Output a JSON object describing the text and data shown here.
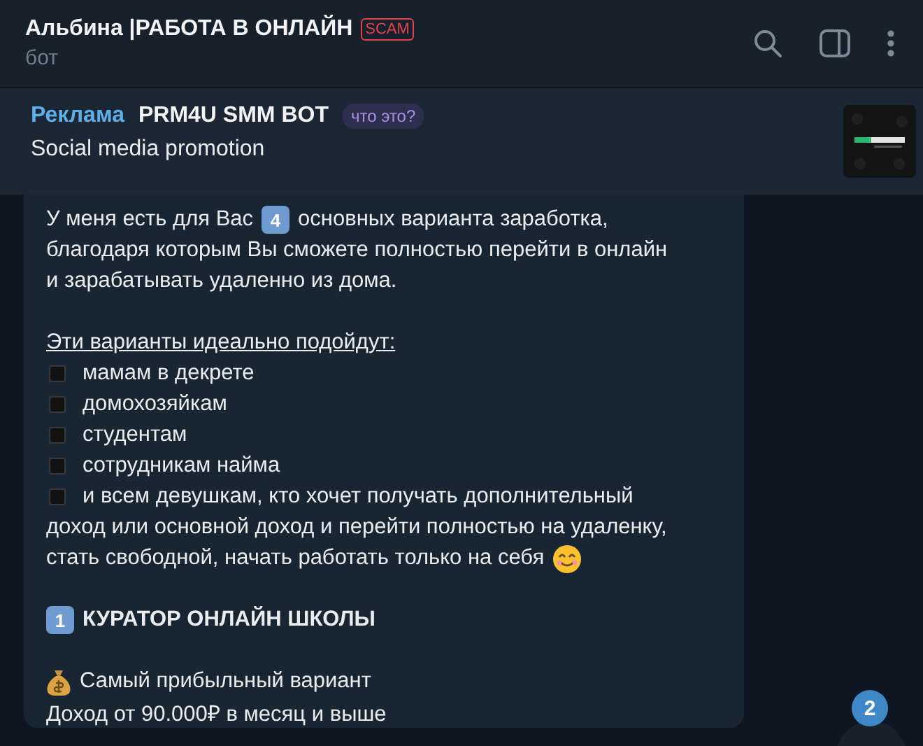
{
  "header": {
    "title": "Альбина |РАБОТА В ОНЛАЙН",
    "badge": "SCAM",
    "subtitle": "бот"
  },
  "sponsored": {
    "label": "Реклама",
    "name": "PRM4U SMM BOT",
    "hint": "что это?",
    "text": "Social media promotion"
  },
  "message": {
    "lines": [
      {
        "kind": "keycap_text",
        "before": "У меня есть для Вас",
        "keycap": "4",
        "after": "основных варианта заработка,"
      },
      {
        "kind": "text",
        "text": "благодаря которым Вы сможете полностью перейти в онлайн"
      },
      {
        "kind": "text",
        "text": "и зарабатывать удаленно из дома."
      },
      {
        "kind": "blank"
      },
      {
        "kind": "underline",
        "text": "Эти варианты идеально подойдут:"
      },
      {
        "kind": "bullet",
        "text": "мамам в декрете"
      },
      {
        "kind": "bullet",
        "text": "домохозяйкам"
      },
      {
        "kind": "bullet",
        "text": "студентам"
      },
      {
        "kind": "bullet",
        "text": "сотрудникам найма"
      },
      {
        "kind": "bullet",
        "text": "и всем девушкам, кто хочет получать дополнительный"
      },
      {
        "kind": "text",
        "text": "доход или основной доход и перейти полностью на удаленку,"
      },
      {
        "kind": "smile_text",
        "text": "стать свободной, начать работать только на себя"
      },
      {
        "kind": "blank"
      },
      {
        "kind": "heading",
        "keycap": "1",
        "text": "КУРАТОР ОНЛАЙН ШКОЛЫ"
      },
      {
        "kind": "blank"
      },
      {
        "kind": "money_text",
        "text": "Самый прибыльный вариант"
      },
      {
        "kind": "text",
        "text": "Доход от 90.000₽ в месяц и выше"
      }
    ]
  },
  "unread_count": "2"
}
